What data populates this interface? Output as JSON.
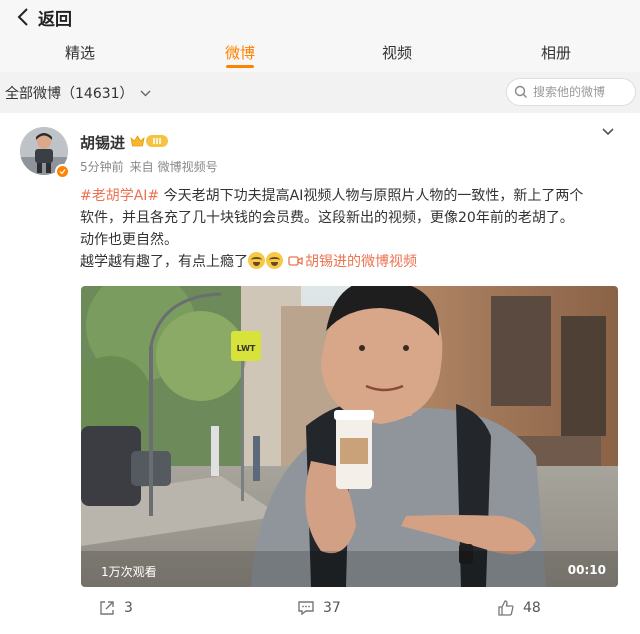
{
  "header": {
    "back_label": "返回"
  },
  "tabs": [
    {
      "label": "精选",
      "active": false
    },
    {
      "label": "微博",
      "active": true
    },
    {
      "label": "视频",
      "active": false
    },
    {
      "label": "相册",
      "active": false
    }
  ],
  "accent_color": "#ff8200",
  "filter": {
    "label": "全部微博（14631）"
  },
  "search": {
    "placeholder": "搜索他的微博"
  },
  "post": {
    "author": "胡锡进",
    "level_badge": "III",
    "time": "5分钟前",
    "from_label": "来自",
    "source": "微博视频号",
    "topic": "#老胡学AI#",
    "line1_rest": " 今天老胡下功夫提高AI视频人物与原照片人物的一致性，新上了两个",
    "line2": "软件，并且各充了几十块钱的会员费。这段新出的视频，更像20年前的老胡了。",
    "line3": "动作也更自然。",
    "line4": "越学越有趣了，有点上瘾了",
    "emoji_count": 2,
    "video_link": "胡锡进的微博视频",
    "video": {
      "views": "1万次观看",
      "duration": "00:10",
      "sign_text": "LWT"
    }
  },
  "actions": {
    "repost_count": "3",
    "comment_count": "37",
    "like_count": "48"
  },
  "icons": [
    "back-chevron-icon",
    "chevron-down-icon",
    "search-icon",
    "verified-icon",
    "crown-icon",
    "more-chevron-icon",
    "video-link-icon",
    "repost-icon",
    "comment-icon",
    "like-icon",
    "laugh-cry-emoji"
  ]
}
